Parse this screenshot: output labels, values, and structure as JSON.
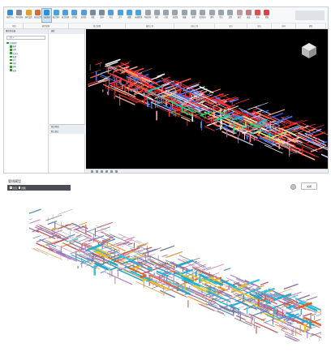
{
  "app": {
    "ribbon": {
      "tools": [
        {
          "label": "模型导入",
          "icon": "model-import-icon",
          "color": "#2f8fd6"
        },
        {
          "label": "构件显隐",
          "icon": "component-visibility-icon",
          "color": "#7a8a99"
        },
        {
          "label": "颜色设置",
          "icon": "color-settings-icon",
          "color": "#e0a030"
        },
        {
          "label": "材质设置",
          "icon": "material-settings-icon",
          "color": "#d96a3a"
        },
        {
          "label": "渲染模式",
          "icon": "render-mode-icon",
          "color": "#2f8fd6"
        },
        {
          "label": "视点保存",
          "icon": "viewpoint-save-icon",
          "color": "#4aa0e0"
        },
        {
          "label": "视点管理",
          "icon": "viewpoint-manage-icon",
          "color": "#4aa0e0"
        },
        {
          "label": "剖切盒",
          "icon": "section-box-icon",
          "color": "#5b9bd5"
        },
        {
          "label": "剖切面",
          "icon": "section-plane-icon",
          "color": "#5b9bd5"
        },
        {
          "label": "测量",
          "icon": "measure-icon",
          "color": "#7a8a99"
        },
        {
          "label": "漫游",
          "icon": "walk-icon",
          "color": "#7a8a99"
        },
        {
          "label": "标注",
          "icon": "annotation-icon",
          "color": "#4aa0e0"
        },
        {
          "label": "文字",
          "icon": "text-icon",
          "color": "#4aa0e0"
        },
        {
          "label": "截图",
          "icon": "screenshot-icon",
          "color": "#4aa0e0"
        },
        {
          "label": "碰撞检测",
          "icon": "clash-detect-icon",
          "color": "#4aa0e0"
        },
        {
          "label": "净高分析",
          "icon": "clearance-icon",
          "color": "#9aa4ae"
        },
        {
          "label": "属性",
          "icon": "property-icon",
          "color": "#9aa4ae"
        },
        {
          "label": "过滤",
          "icon": "filter-icon",
          "color": "#9aa4ae"
        },
        {
          "label": "选择集",
          "icon": "selection-set-icon",
          "color": "#9aa4ae"
        },
        {
          "label": "隐藏",
          "icon": "hide-icon",
          "color": "#9aa4ae"
        },
        {
          "label": "隔离",
          "icon": "isolate-icon",
          "color": "#9aa4ae"
        },
        {
          "label": "全部显示",
          "icon": "show-all-icon",
          "color": "#9aa4ae"
        },
        {
          "label": "透明",
          "icon": "transparent-icon",
          "color": "#9aa4ae"
        },
        {
          "label": "导出",
          "icon": "export-icon",
          "color": "#9aa4ae"
        },
        {
          "label": "设置",
          "icon": "settings-icon",
          "color": "#9aa4ae"
        },
        {
          "label": "报告",
          "icon": "report-icon",
          "color": "#b9a0a0"
        },
        {
          "label": "进度",
          "icon": "progress-icon",
          "color": "#c08080"
        },
        {
          "label": "发布",
          "icon": "publish-icon",
          "color": "#d95050"
        },
        {
          "label": "帮助",
          "icon": "help-icon",
          "color": "#e04040"
        }
      ],
      "groups": [
        {
          "label": "项目",
          "width": 22
        },
        {
          "label": "模型管理",
          "width": 56
        },
        {
          "label": "视点管理",
          "width": 70
        },
        {
          "label": "辅助工具",
          "width": 60
        },
        {
          "label": "分析工具",
          "width": 50
        },
        {
          "label": "显示",
          "width": 40
        },
        {
          "label": "导出",
          "width": 30
        },
        {
          "label": "协同",
          "width": 30
        },
        {
          "label": "帮助",
          "width": 37
        }
      ]
    },
    "left_panel": {
      "title": "模型浏览器",
      "search_value": "全部 ▾",
      "tree": [
        "全部模型",
        "建筑",
        "结构",
        "给排水",
        "暖通",
        "电气",
        "消防",
        "弱电",
        "装饰"
      ]
    },
    "mid_panel": {
      "title": "属性",
      "lower_title": "视点列表",
      "lower_item": "默认视点"
    }
  },
  "viewer": {
    "title": "管线模型",
    "tabs": [
      "全选",
      "隐藏"
    ],
    "button_label": "关闭"
  }
}
